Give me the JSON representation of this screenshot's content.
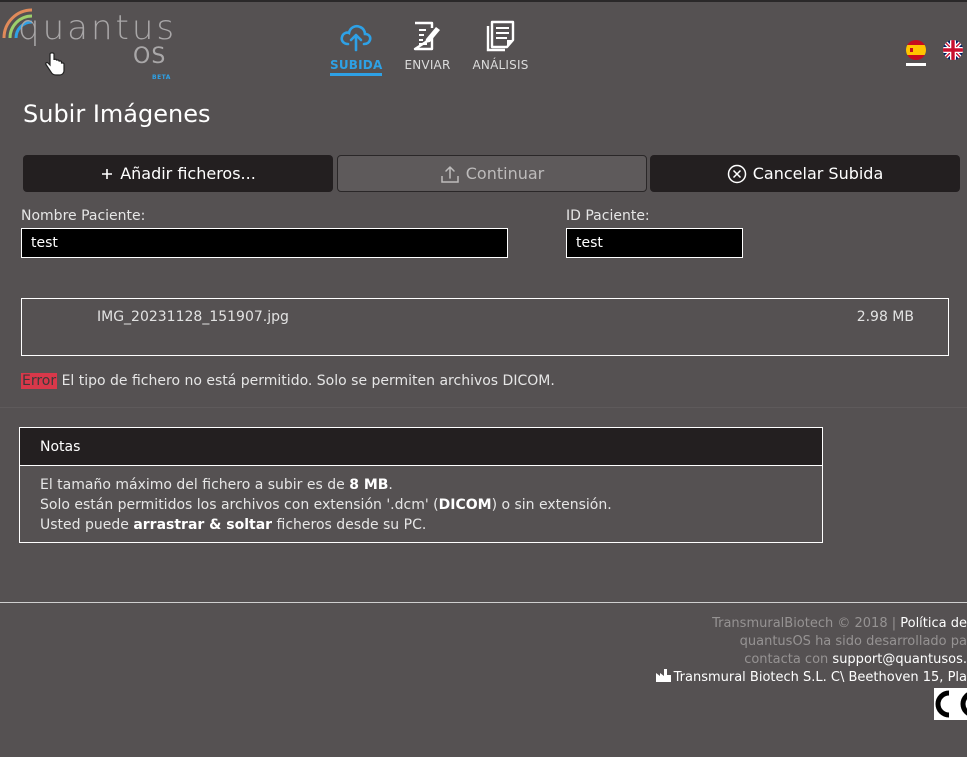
{
  "logo": {
    "word": "quantus",
    "os": "OS",
    "beta": "BETA"
  },
  "nav": [
    {
      "label": "SUBIDA",
      "icon": "cloud-upload-icon",
      "active": true
    },
    {
      "label": "ENVIAR",
      "icon": "edit-document-icon",
      "active": false
    },
    {
      "label": "ANÁLISIS",
      "icon": "document-list-icon",
      "active": false
    }
  ],
  "languages": [
    "es",
    "en"
  ],
  "page": {
    "title": "Subir Imágenes"
  },
  "buttons": {
    "add": "Añadir ficheros...",
    "continue": "Continuar",
    "cancel": "Cancelar Subida"
  },
  "form": {
    "patient_name_label": "Nombre Paciente:",
    "patient_name_value": "test",
    "patient_id_label": "ID Paciente:",
    "patient_id_value": "test"
  },
  "file": {
    "name": "IMG_20231128_151907.jpg",
    "size": "2.98 MB"
  },
  "error": {
    "badge": "Error",
    "message": " El tipo de fichero no está permitido. Solo se permiten archivos DICOM."
  },
  "notes": {
    "title": "Notas",
    "line1_pre": "El tamaño máximo del fichero a subir es de ",
    "line1_bold": "8 MB",
    "line1_post": ".",
    "line2_pre": "Solo están permitidos los archivos con extensión '.dcm' (",
    "line2_bold": "DICOM",
    "line2_post": ") o sin extensión.",
    "line3_pre": "Usted puede ",
    "line3_bold": "arrastrar & soltar",
    "line3_post": " ficheros desde su PC."
  },
  "footer": {
    "copyright": "TransmuralBiotech © 2018 | ",
    "policy": "Política de",
    "developed": "quantusOS ha sido desarrollado pa",
    "contact_pre": "contacta con ",
    "contact_email": "support@quantusos.",
    "address": "Transmural Biotech S.L. C\\ Beethoven 15, Pla"
  },
  "colors": {
    "accent": "#2ea1e6",
    "error": "#d8384a",
    "background": "#555152",
    "dark": "#231f20"
  }
}
